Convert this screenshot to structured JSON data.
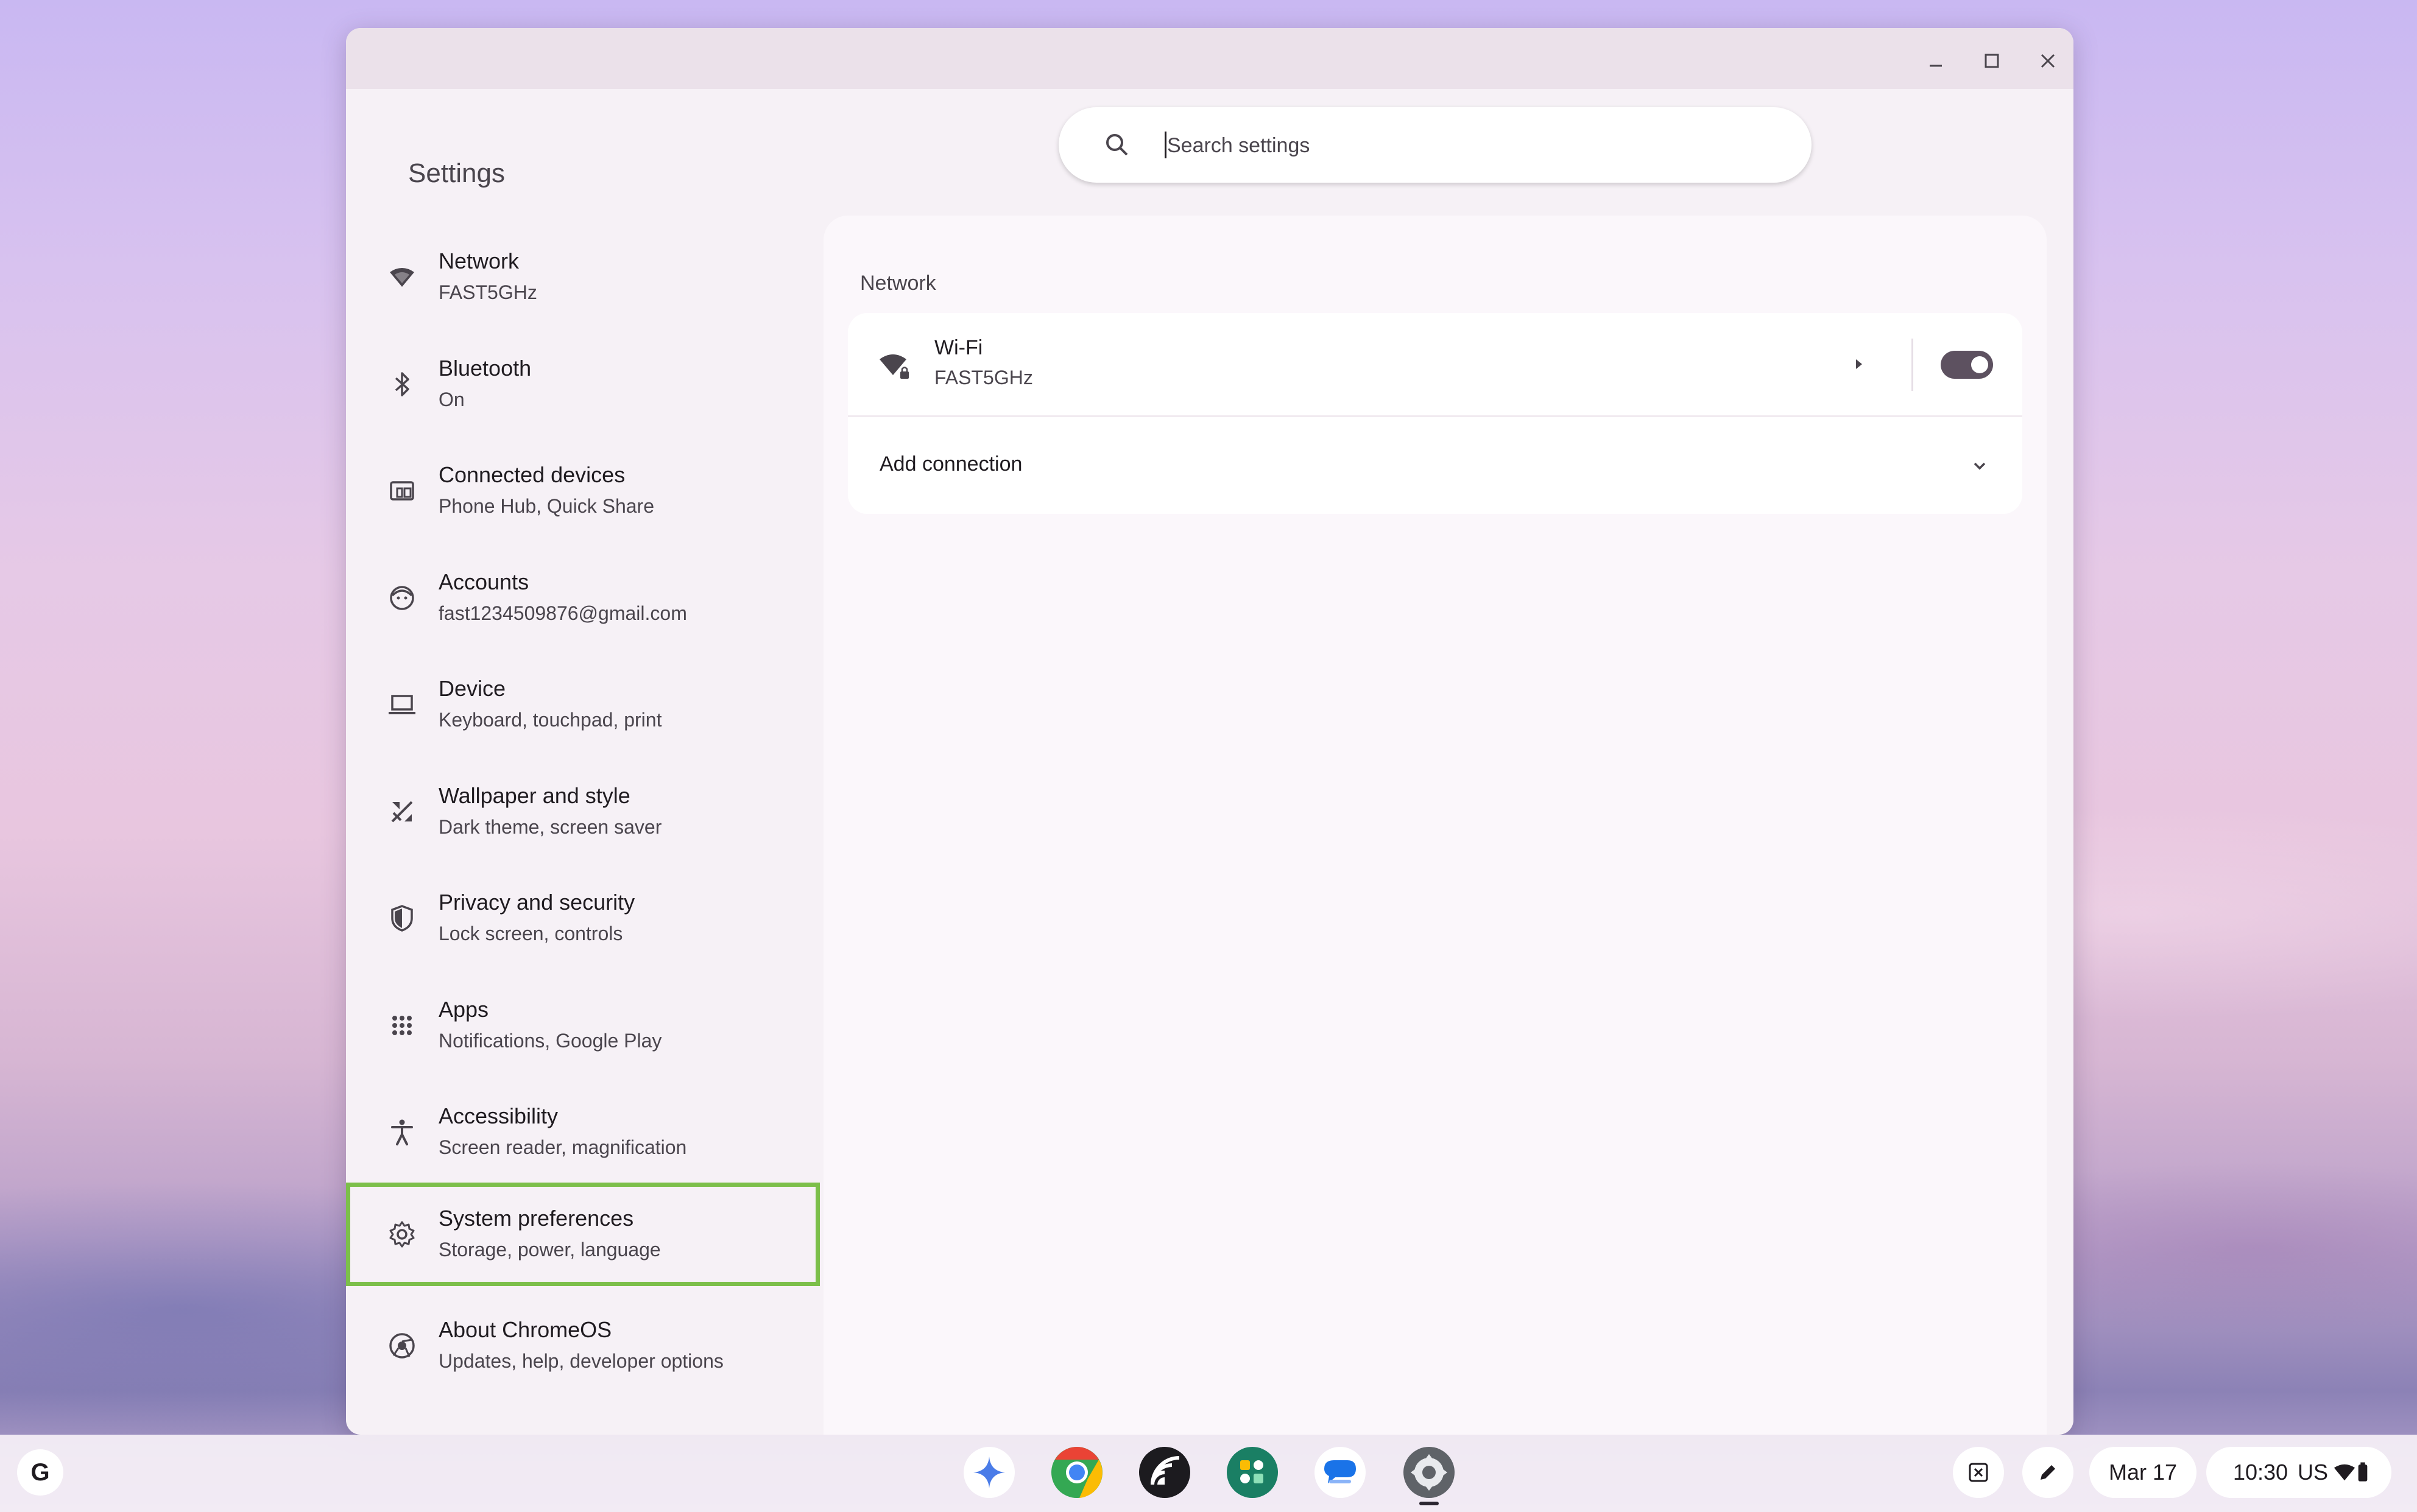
{
  "window": {
    "app_title": "Settings",
    "search": {
      "placeholder": "Search settings"
    }
  },
  "sidebar": {
    "items": [
      {
        "title": "Network",
        "subtitle": "FAST5GHz",
        "icon": "wifi-icon"
      },
      {
        "title": "Bluetooth",
        "subtitle": "On",
        "icon": "bluetooth-icon"
      },
      {
        "title": "Connected devices",
        "subtitle": "Phone Hub, Quick Share",
        "icon": "connected-devices-icon"
      },
      {
        "title": "Accounts",
        "subtitle": "fast1234509876@gmail.com",
        "icon": "account-icon"
      },
      {
        "title": "Device",
        "subtitle": "Keyboard, touchpad, print",
        "icon": "laptop-icon"
      },
      {
        "title": "Wallpaper and style",
        "subtitle": "Dark theme, screen saver",
        "icon": "palette-brush-icon"
      },
      {
        "title": "Privacy and security",
        "subtitle": "Lock screen, controls",
        "icon": "shield-icon"
      },
      {
        "title": "Apps",
        "subtitle": "Notifications, Google Play",
        "icon": "apps-grid-icon"
      },
      {
        "title": "Accessibility",
        "subtitle": "Screen reader, magnification",
        "icon": "accessibility-icon"
      },
      {
        "title": "System preferences",
        "subtitle": "Storage, power, language",
        "icon": "gear-icon",
        "selected": true
      },
      {
        "title": "About ChromeOS",
        "subtitle": "Updates, help, developer options",
        "icon": "chromeos-icon"
      }
    ]
  },
  "main": {
    "section_title": "Network",
    "wifi": {
      "title": "Wi-Fi",
      "subtitle": "FAST5GHz",
      "enabled": true
    },
    "add_connection": "Add connection"
  },
  "shelf": {
    "launcher": "G",
    "apps": [
      "gemini-icon",
      "chrome-icon",
      "nearby-stream-icon",
      "google-one-icon",
      "messages-icon",
      "settings-icon"
    ],
    "date": "Mar 17",
    "time": "10:30",
    "locale": "US"
  },
  "colors": {
    "accent_selected_outline": "#7cbf4a",
    "toggle_on": "#5d5160",
    "window_bg": "#f6f1f6"
  }
}
